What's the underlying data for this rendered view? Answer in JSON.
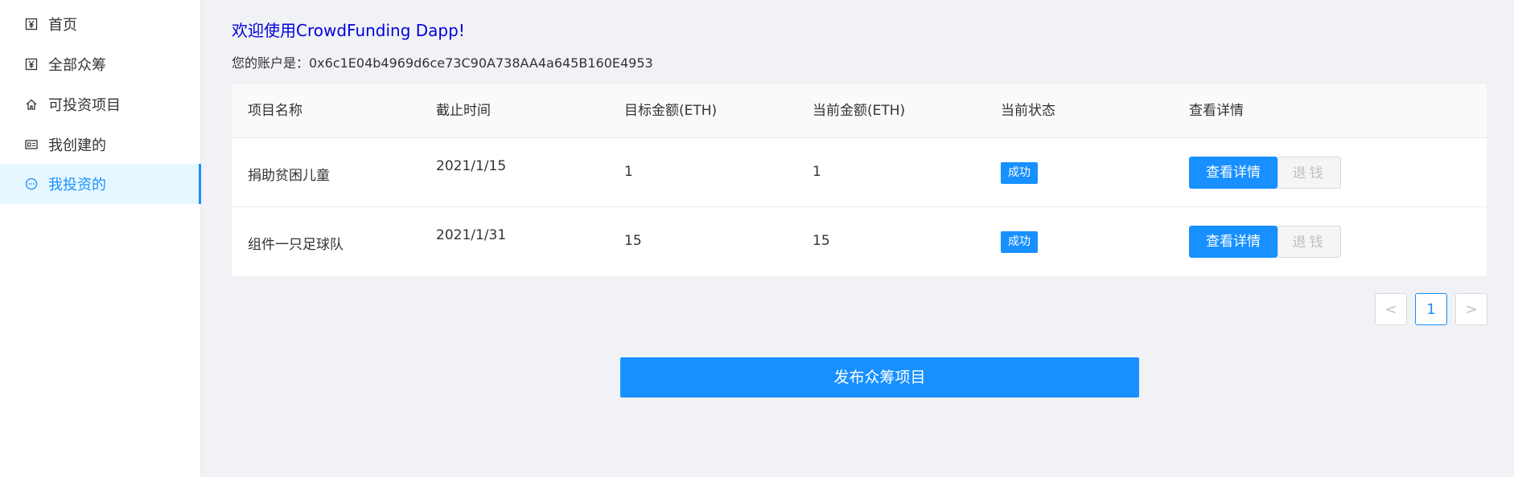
{
  "sidebar": {
    "items": [
      {
        "label": "首页",
        "icon": "yen-icon",
        "active": false
      },
      {
        "label": "全部众筹",
        "icon": "yen-icon",
        "active": false
      },
      {
        "label": "可投资项目",
        "icon": "home-icon",
        "active": false
      },
      {
        "label": "我创建的",
        "icon": "id-card-icon",
        "active": false
      },
      {
        "label": "我投资的",
        "icon": "chat-bubble-icon",
        "active": true
      }
    ]
  },
  "header": {
    "welcome": "欢迎使用CrowdFunding Dapp!",
    "account": "您的账户是：0x6c1E04b4969d6ce73C90A738AA4a645B160E4953"
  },
  "table": {
    "columns": [
      "项目名称",
      "截止时间",
      "目标金额(ETH)",
      "当前金额(ETH)",
      "当前状态",
      "查看详情"
    ],
    "rows": [
      {
        "name": "捐助贫困儿童",
        "deadline": "2021/1/15",
        "target": "1",
        "current": "1",
        "status": "成功",
        "detail_label": "查看详情",
        "refund_label": "退钱"
      },
      {
        "name": "组件一只足球队",
        "deadline": "2021/1/31",
        "target": "15",
        "current": "15",
        "status": "成功",
        "detail_label": "查看详情",
        "refund_label": "退钱"
      }
    ]
  },
  "pagination": {
    "prev": "<",
    "current_page": "1",
    "next": ">"
  },
  "publish_button": "发布众筹项目",
  "colors": {
    "primary": "#1890ff",
    "welcome": "#0000dd",
    "active_bg": "#e6f7ff"
  }
}
